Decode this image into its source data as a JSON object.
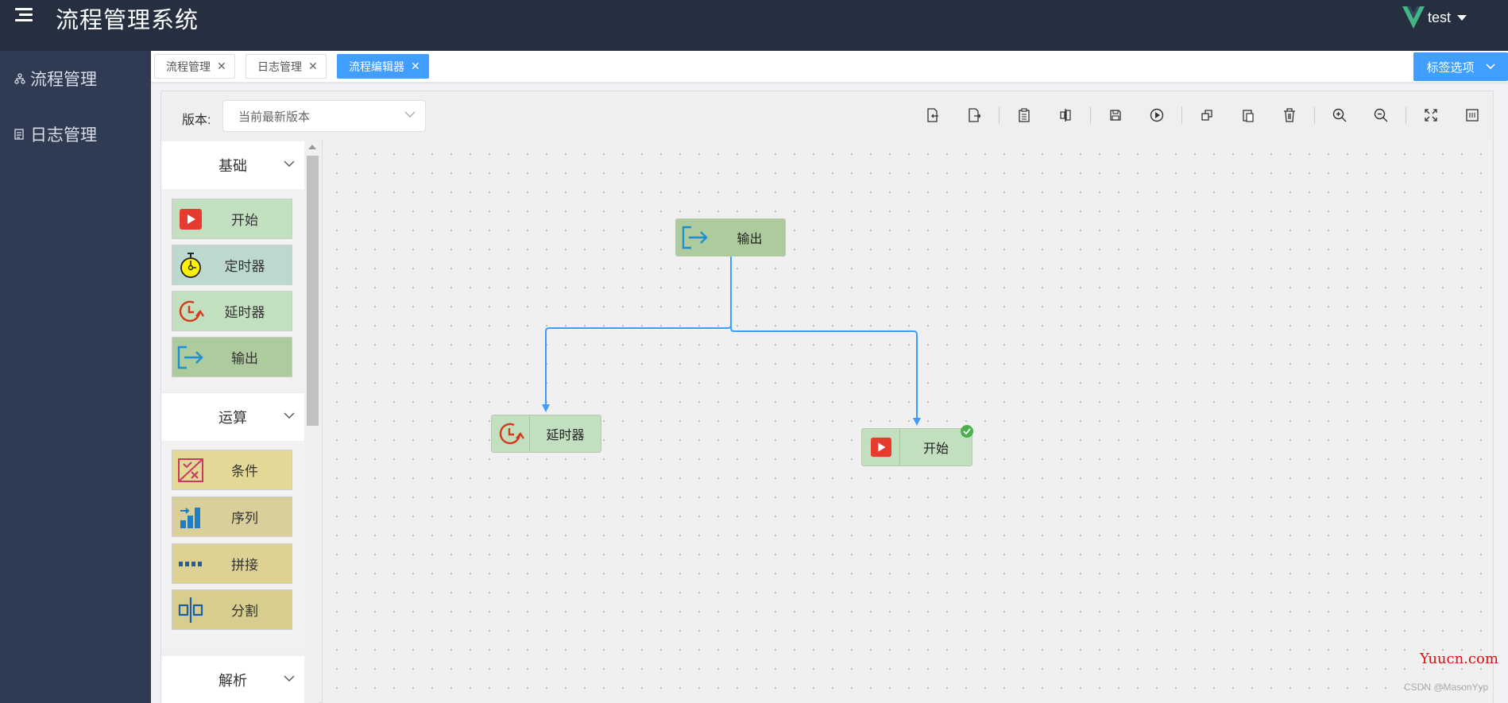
{
  "app": {
    "title": "流程管理系统",
    "user": "test"
  },
  "sidebar": {
    "items": [
      {
        "label": "流程管理",
        "icon": "flow-tree-icon"
      },
      {
        "label": "日志管理",
        "icon": "document-icon"
      }
    ]
  },
  "tabs": {
    "items": [
      {
        "label": "流程管理",
        "active": false
      },
      {
        "label": "日志管理",
        "active": false
      },
      {
        "label": "流程编辑器",
        "active": true
      }
    ],
    "options_label": "标签选项"
  },
  "editor": {
    "version_label": "版本:",
    "version_value": "当前最新版本",
    "toolbar_icons": [
      "import-icon",
      "export-icon",
      "clipboard-icon",
      "align-icon",
      "save-icon",
      "run-icon",
      "copy-icon",
      "paste-icon",
      "delete-icon",
      "zoom-in-icon",
      "zoom-out-icon",
      "fullscreen-icon",
      "minimap-icon"
    ]
  },
  "palette": {
    "groups": [
      {
        "title": "基础",
        "items": [
          {
            "label": "开始",
            "icon": "start-play-icon"
          },
          {
            "label": "定时器",
            "icon": "stopwatch-icon"
          },
          {
            "label": "延时器",
            "icon": "delay-clock-icon"
          },
          {
            "label": "输出",
            "icon": "output-arrow-icon"
          }
        ]
      },
      {
        "title": "运算",
        "items": [
          {
            "label": "条件",
            "icon": "condition-icon"
          },
          {
            "label": "序列",
            "icon": "sequence-icon"
          },
          {
            "label": "拼接",
            "icon": "concat-icon"
          },
          {
            "label": "分割",
            "icon": "split-icon"
          }
        ]
      },
      {
        "title": "解析",
        "items": []
      }
    ]
  },
  "canvas": {
    "nodes": [
      {
        "label": "输出",
        "icon": "output-arrow-icon"
      },
      {
        "label": "延时器",
        "icon": "delay-clock-icon"
      },
      {
        "label": "开始",
        "icon": "start-play-icon",
        "status": "success"
      }
    ]
  },
  "watermark": {
    "site": "Yuucn.com",
    "credit": "CSDN @MasonYyp"
  },
  "colors": {
    "header": "#252f40",
    "sidebar": "#2f3b52",
    "accent": "#409eff",
    "edge": "#3f9bff",
    "node_green": "#c2dfc0",
    "node_yellow": "#e3d896"
  }
}
